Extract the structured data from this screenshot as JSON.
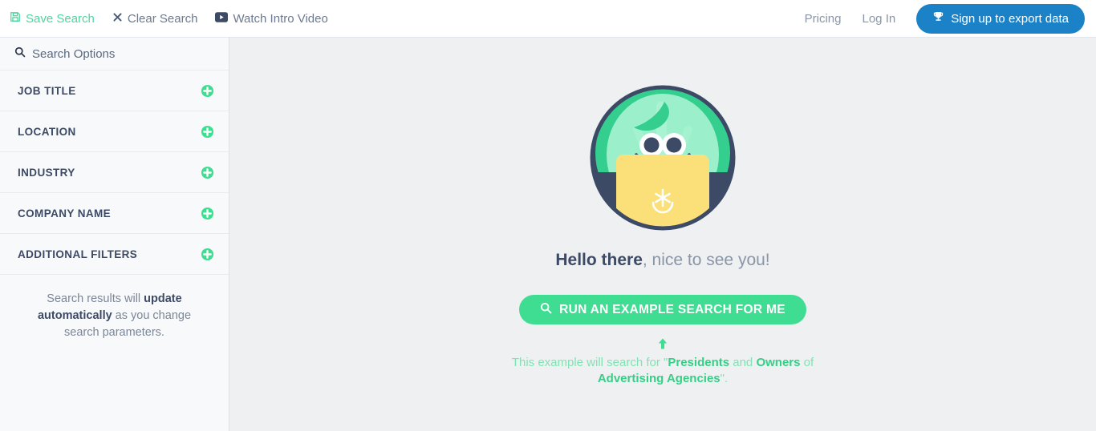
{
  "header": {
    "actions": [
      {
        "label": "Save Search",
        "icon": "save-icon"
      },
      {
        "label": "Clear Search",
        "icon": "close-x-icon"
      },
      {
        "label": "Watch Intro Video",
        "icon": "play-video-icon"
      }
    ],
    "links": [
      {
        "label": "Pricing"
      },
      {
        "label": "Log In"
      }
    ],
    "signup_label": "Sign up to export data",
    "signup_icon": "trophy-icon",
    "signup_color": "#1b82c8"
  },
  "sidebar": {
    "title": "Search Options",
    "title_icon": "search-icon",
    "filters": [
      {
        "label": "JOB TITLE",
        "icon": "plus-circle-icon"
      },
      {
        "label": "LOCATION",
        "icon": "plus-circle-icon"
      },
      {
        "label": "INDUSTRY",
        "icon": "plus-circle-icon"
      },
      {
        "label": "COMPANY NAME",
        "icon": "plus-circle-icon"
      },
      {
        "label": "ADDITIONAL FILTERS",
        "icon": "plus-circle-icon"
      }
    ],
    "note": {
      "part1": "Search results will ",
      "bold": "update automatically",
      "part2": " as you change search parameters."
    },
    "accent_color": "#3fdd92"
  },
  "main": {
    "mascot_icon": "robot-avatar-illustration",
    "greeting": {
      "bold": "Hello there",
      "rest": ", nice to see you!"
    },
    "run_button": {
      "label": "RUN AN EXAMPLE SEARCH FOR ME",
      "icon": "search-icon",
      "color": "#3fdd92"
    },
    "arrow_icon": "arrow-up-icon",
    "example_note": {
      "part1": "This example will search for \"",
      "bold1": "Presidents",
      "part2": " and ",
      "bold2": "Owners",
      "part3": " of ",
      "bold3": "Advertising Agencies",
      "part4": "\"."
    }
  }
}
